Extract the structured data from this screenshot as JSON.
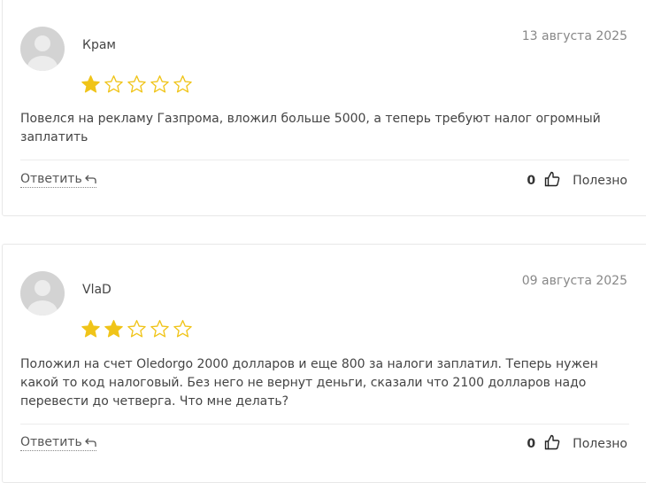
{
  "reviews": [
    {
      "author": "Крам",
      "date": "13 августа 2025",
      "rating": 1,
      "max_rating": 5,
      "text": "Повелся на рекламу Газпрома, вложил больше 5000, а теперь требуют налог огромный заплатить",
      "reply_label": "Ответить",
      "votes": "0",
      "useful_label": "Полезно"
    },
    {
      "author": "VlaD",
      "date": "09 августа 2025",
      "rating": 2,
      "max_rating": 5,
      "text": "Положил на счет Oledorgo 2000 долларов и еще 800 за налоги заплатил. Теперь нужен какой то код налоговый. Без него не вернут деньги, сказали что 2100 долларов надо перевести до четверга. Что мне делать?",
      "reply_label": "Ответить",
      "votes": "0",
      "useful_label": "Полезно"
    }
  ],
  "colors": {
    "star_filled": "#f0c419",
    "star_empty": "#f0c419",
    "avatar_bg": "#d3d3d3"
  },
  "icons": {
    "reply": "reply-arrow-icon",
    "like": "thumbs-up-icon",
    "avatar": "user-silhouette-icon",
    "star": "star-icon"
  }
}
